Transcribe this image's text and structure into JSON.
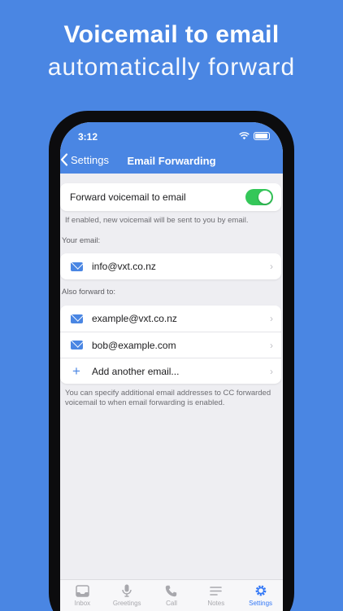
{
  "promo": {
    "headline": "Voicemail to email",
    "subhead": "automatically forward"
  },
  "status": {
    "time": "3:12"
  },
  "nav": {
    "back_label": "Settings",
    "title": "Email Forwarding"
  },
  "forward_toggle": {
    "label": "Forward voicemail to email",
    "enabled": true,
    "note": "If enabled, new voicemail will be sent to you by email."
  },
  "your_email": {
    "section_label": "Your email:",
    "address": "info@vxt.co.nz"
  },
  "also_forward": {
    "section_label": "Also forward to:",
    "addresses": [
      "example@vxt.co.nz",
      "bob@example.com"
    ],
    "add_label": "Add another email...",
    "note": "You can specify additional email addresses to CC forwarded voicemail to when email forwarding is enabled."
  },
  "tabs": [
    {
      "label": "Inbox",
      "icon": "inbox-icon"
    },
    {
      "label": "Greetings",
      "icon": "microphone-icon"
    },
    {
      "label": "Call",
      "icon": "phone-icon"
    },
    {
      "label": "Notes",
      "icon": "notes-icon"
    },
    {
      "label": "Settings",
      "icon": "gear-icon"
    }
  ],
  "colors": {
    "brand_blue": "#4a86e3",
    "toggle_on": "#34c759",
    "tab_active": "#3478f6"
  }
}
